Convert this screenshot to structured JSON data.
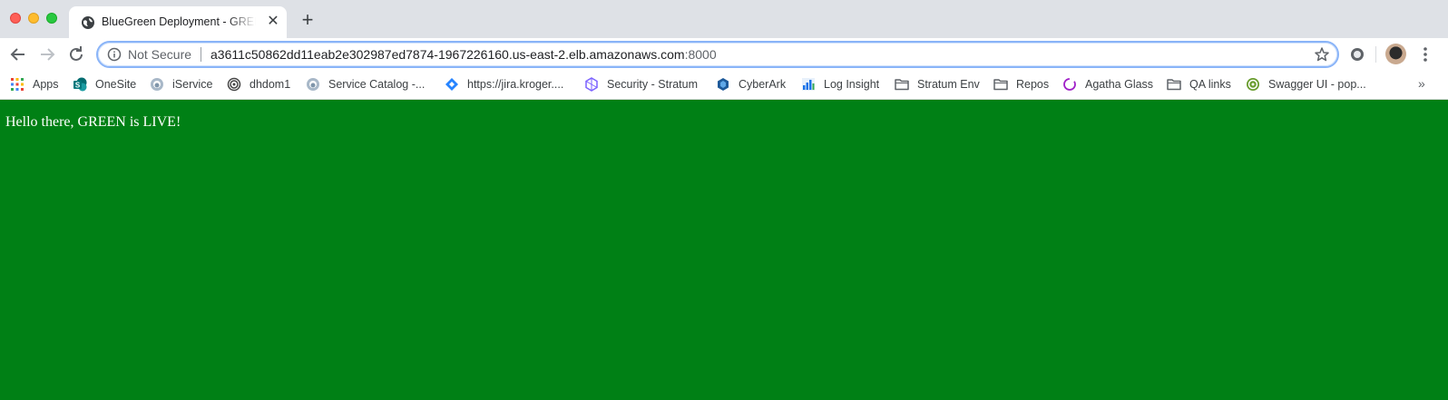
{
  "window": {
    "controls": [
      "close",
      "minimize",
      "maximize"
    ]
  },
  "tab": {
    "title": "BlueGreen Deployment - GREEN",
    "icon": "globe-icon",
    "close_glyph": "✕"
  },
  "new_tab_glyph": "+",
  "omnibox": {
    "security_label": "Not Secure",
    "url_host": "a3611c50862dd11eab2e302987ed7874-1967226160.us-east-2.elb.amazonaws.com",
    "url_port": ":8000"
  },
  "bookmarks": [
    {
      "label": "Apps",
      "icon": "apps-grid-icon"
    },
    {
      "label": "OneSite",
      "icon": "sharepoint-icon"
    },
    {
      "label": "iService",
      "icon": "iservice-icon"
    },
    {
      "label": "dhdom1",
      "icon": "spiral-icon"
    },
    {
      "label": "Service Catalog -...",
      "icon": "catalog-icon"
    },
    {
      "label": "https://jira.kroger....",
      "icon": "jira-icon"
    },
    {
      "label": "Security - Stratum",
      "icon": "hexagon-icon"
    },
    {
      "label": "CyberArk",
      "icon": "cyberark-icon"
    },
    {
      "label": "Log Insight",
      "icon": "bar-chart-icon"
    },
    {
      "label": "Stratum Env",
      "icon": "folder-icon"
    },
    {
      "label": "Repos",
      "icon": "folder-icon"
    },
    {
      "label": "Agatha Glass",
      "icon": "ring-icon"
    },
    {
      "label": "QA links",
      "icon": "folder-icon"
    },
    {
      "label": "Swagger UI - pop...",
      "icon": "swagger-icon"
    }
  ],
  "overflow_glyph": "»",
  "page": {
    "message": "Hello there, GREEN is LIVE!",
    "background_color": "#008015",
    "text_color": "#ffffff"
  },
  "colors": {
    "tabstrip": "#dee1e6",
    "omnibox_focus": "#8ab4f8"
  }
}
